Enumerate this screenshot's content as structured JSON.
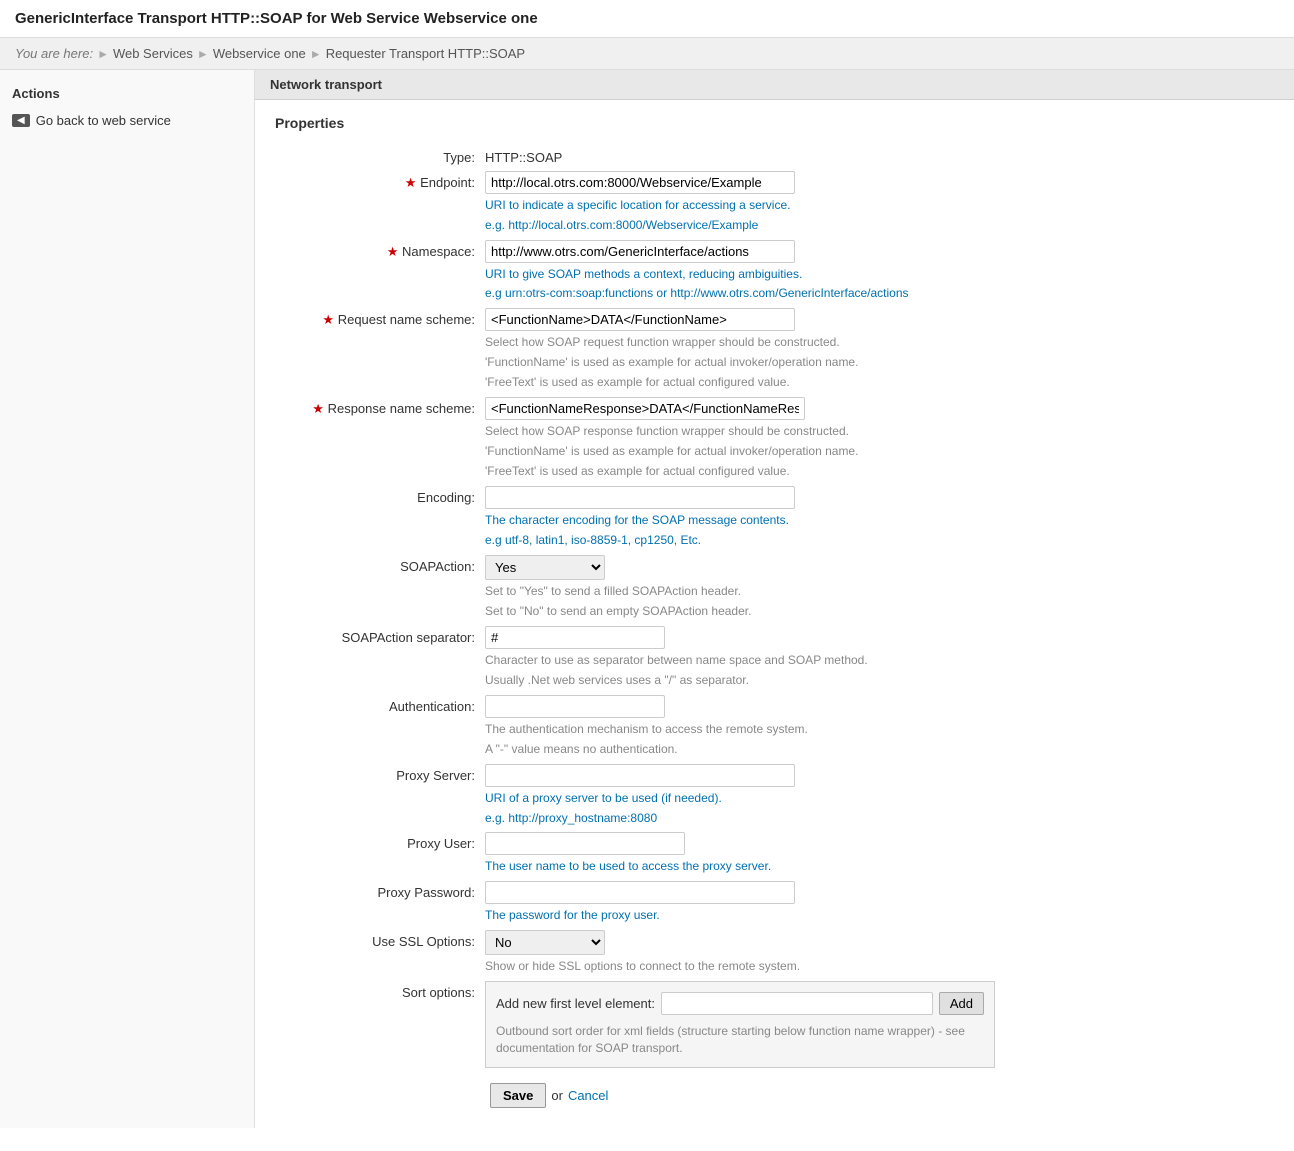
{
  "page": {
    "title": "GenericInterface Transport HTTP::SOAP for Web Service Webservice one"
  },
  "breadcrumb": {
    "you_are_here": "You are here:",
    "items": [
      {
        "label": "Web Services"
      },
      {
        "label": "Webservice one"
      },
      {
        "label": "Requester Transport HTTP::SOAP"
      }
    ]
  },
  "sidebar": {
    "title": "Actions",
    "back_label": "Go back to web service"
  },
  "network_transport": {
    "section_title": "Network transport",
    "properties_title": "Properties"
  },
  "form": {
    "type_label": "Type:",
    "type_value": "HTTP::SOAP",
    "endpoint_label": "Endpoint:",
    "endpoint_value": "http://local.otrs.com:8000/Webservice/Example",
    "endpoint_help1": "URI to indicate a specific location for accessing a service.",
    "endpoint_help2": "e.g. http://local.otrs.com:8000/Webservice/Example",
    "namespace_label": "Namespace:",
    "namespace_value": "http://www.otrs.com/GenericInterface/actions",
    "namespace_help1": "URI to give SOAP methods a context, reducing ambiguities.",
    "namespace_help2": "e.g urn:otrs-com:soap:functions or http://www.otrs.com/GenericInterface/actions",
    "request_name_scheme_label": "Request name scheme:",
    "request_name_scheme_value": "<FunctionName>DATA</FunctionName>",
    "request_name_scheme_help1": "Select how SOAP request function wrapper should be constructed.",
    "request_name_scheme_help2": "'FunctionName' is used as example for actual invoker/operation name.",
    "request_name_scheme_help3": "'FreeText' is used as example for actual configured value.",
    "response_name_scheme_label": "Response name scheme:",
    "response_name_scheme_value": "<FunctionNameResponse>DATA</FunctionNameResponse>",
    "response_name_scheme_help1": "Select how SOAP response function wrapper should be constructed.",
    "response_name_scheme_help2": "'FunctionName' is used as example for actual invoker/operation name.",
    "response_name_scheme_help3": "'FreeText' is used as example for actual configured value.",
    "encoding_label": "Encoding:",
    "encoding_value": "",
    "encoding_help1": "The character encoding for the SOAP message contents.",
    "encoding_help2": "e.g utf-8, latin1, iso-8859-1, cp1250, Etc.",
    "soap_action_label": "SOAPAction:",
    "soap_action_value": "Yes",
    "soap_action_help1": "Set to \"Yes\" to send a filled SOAPAction header.",
    "soap_action_help2": "Set to \"No\" to send an empty SOAPAction header.",
    "soap_action_separator_label": "SOAPAction separator:",
    "soap_action_separator_value": "#",
    "soap_action_separator_help1": "Character to use as separator between name space and SOAP method.",
    "soap_action_separator_help2": "Usually .Net web services uses a \"/\" as separator.",
    "authentication_label": "Authentication:",
    "authentication_value": "",
    "authentication_help1": "The authentication mechanism to access the remote system.",
    "authentication_help2": "A \"-\" value means no authentication.",
    "proxy_server_label": "Proxy Server:",
    "proxy_server_value": "",
    "proxy_server_help1": "URI of a proxy server to be used (if needed).",
    "proxy_server_help2": "e.g. http://proxy_hostname:8080",
    "proxy_user_label": "Proxy User:",
    "proxy_user_value": "",
    "proxy_user_help": "The user name to be used to access the proxy server.",
    "proxy_password_label": "Proxy Password:",
    "proxy_password_value": "",
    "proxy_password_help": "The password for the proxy user.",
    "ssl_options_label": "Use SSL Options:",
    "ssl_options_value": "No",
    "ssl_options_help": "Show or hide SSL options to connect to the remote system.",
    "sort_options_label": "Sort options:",
    "sort_options_add_label": "Add new first level element:",
    "sort_options_add_btn": "Add",
    "sort_options_note": "Outbound sort order for xml fields (structure starting below function name wrapper) - see documentation for SOAP transport.",
    "save_btn": "Save",
    "or_text": "or",
    "cancel_link": "Cancel"
  }
}
